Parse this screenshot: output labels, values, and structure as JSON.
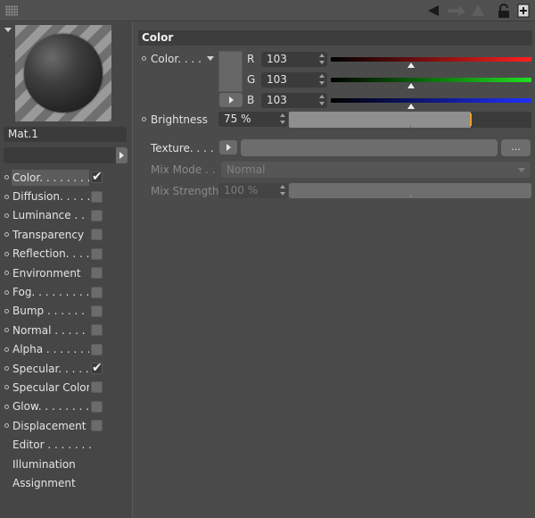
{
  "toolbar": {
    "grip_icon": "grip-icon",
    "nav_icons": [
      "back-arrow-icon",
      "forward-arrow-icon",
      "up-arrow-icon",
      "lock-icon",
      "new-window-icon"
    ]
  },
  "material": {
    "name": "Mat.1"
  },
  "channels": [
    {
      "label": "Color. . . . . . . .",
      "enabled": true,
      "has_checkbox": true,
      "active": true
    },
    {
      "label": "Diffusion. . . . . .",
      "enabled": false,
      "has_checkbox": true
    },
    {
      "label": "Luminance . . . .",
      "enabled": false,
      "has_checkbox": true
    },
    {
      "label": "Transparency",
      "enabled": false,
      "has_checkbox": true
    },
    {
      "label": "Reflection. . . . .",
      "enabled": false,
      "has_checkbox": true
    },
    {
      "label": "Environment",
      "enabled": false,
      "has_checkbox": true
    },
    {
      "label": "Fog. . . . . . . . . .",
      "enabled": false,
      "has_checkbox": true
    },
    {
      "label": "Bump . . . . . . . .",
      "enabled": false,
      "has_checkbox": true
    },
    {
      "label": "Normal . . . . . . .",
      "enabled": false,
      "has_checkbox": true
    },
    {
      "label": "Alpha . . . . . . . .",
      "enabled": false,
      "has_checkbox": true
    },
    {
      "label": "Specular. . . . . .",
      "enabled": true,
      "has_checkbox": true
    },
    {
      "label": "Specular Color",
      "enabled": false,
      "has_checkbox": true
    },
    {
      "label": "Glow. . . . . . . . .",
      "enabled": false,
      "has_checkbox": true
    },
    {
      "label": "Displacement",
      "enabled": false,
      "has_checkbox": true
    }
  ],
  "tools": [
    {
      "label": "Editor . . . . . . ."
    },
    {
      "label": "Illumination"
    },
    {
      "label": "Assignment"
    }
  ],
  "color_section": {
    "title": "Color",
    "color_label": "Color. . . .",
    "channels": [
      {
        "name": "R",
        "value": "103",
        "gradient": [
          "#000000",
          "#ff2020"
        ],
        "fraction": 0.4
      },
      {
        "name": "G",
        "value": "103",
        "gradient": [
          "#000000",
          "#20e020"
        ],
        "fraction": 0.4
      },
      {
        "name": "B",
        "value": "103",
        "gradient": [
          "#000000",
          "#2030ff"
        ],
        "fraction": 0.4
      }
    ],
    "swatch_color": "#676767",
    "brightness_label": "Brightness",
    "brightness_value": "75 %",
    "brightness_fraction": 0.75,
    "texture_label": "Texture. . . .",
    "texture_button": "...",
    "mix_mode_label": "Mix Mode . .",
    "mix_mode_value": "Normal",
    "mix_strength_label": "Mix Strength",
    "mix_strength_value": "100 %"
  },
  "colors": {
    "accent_marker": "#f0a020",
    "panel": "#4b4b4b",
    "field": "#3b3b3b"
  }
}
